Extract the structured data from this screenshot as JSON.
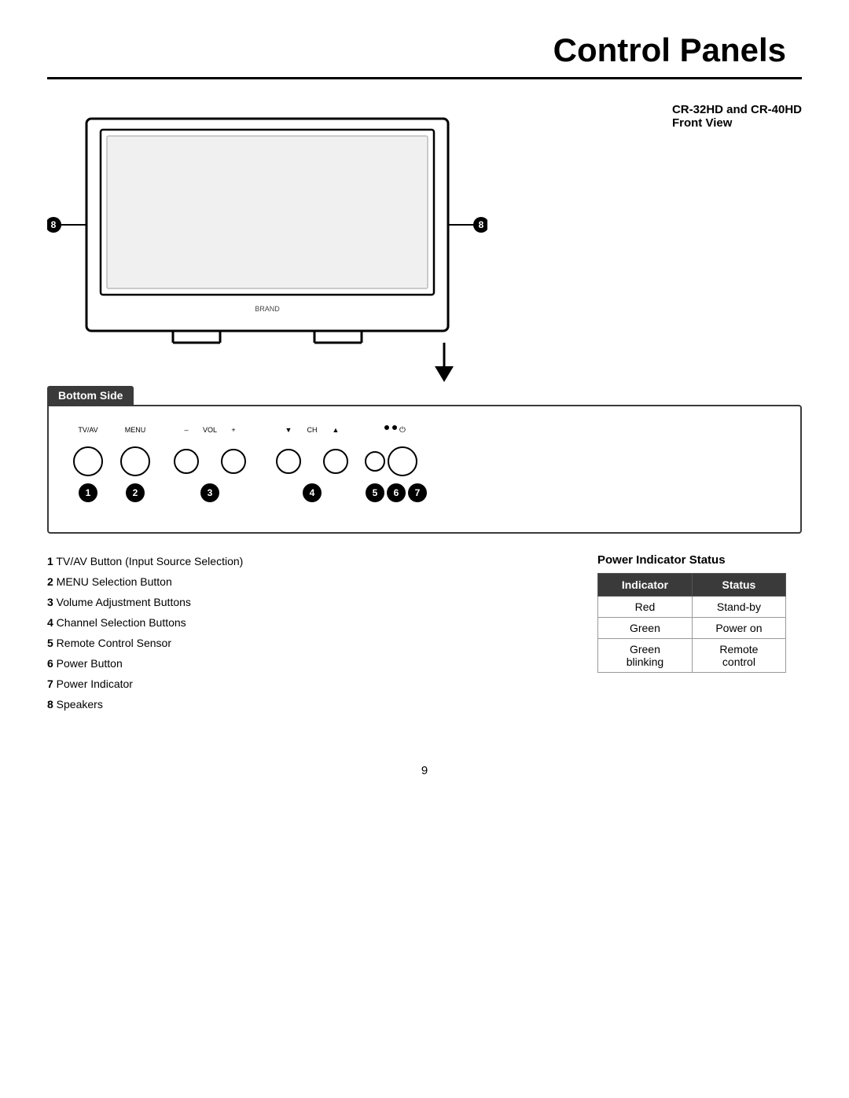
{
  "page": {
    "title": "Control Panels",
    "page_number": "9"
  },
  "header": {
    "model": "CR-32HD and CR-40HD",
    "view": "Front View"
  },
  "labels": {
    "bottom_side": "Bottom Side",
    "power_indicator_status": "Power Indicator Status"
  },
  "control_panel_labels": {
    "tv_av": "TV/AV",
    "menu": "MENU",
    "vol_minus": "–",
    "vol": "VOL",
    "vol_plus": "+",
    "ch_down": "▼",
    "ch": "CH",
    "ch_up": "▲",
    "power_icon": "⏻"
  },
  "legend": [
    {
      "num": "1",
      "text": "TV/AV Button (Input Source Selection)"
    },
    {
      "num": "2",
      "text": "MENU Selection Button"
    },
    {
      "num": "3",
      "text": "Volume Adjustment Buttons"
    },
    {
      "num": "4",
      "text": "Channel Selection Buttons"
    },
    {
      "num": "5",
      "text": "Remote Control Sensor"
    },
    {
      "num": "6",
      "text": "Power Button"
    },
    {
      "num": "7",
      "text": "Power Indicator"
    },
    {
      "num": "8",
      "text": "Speakers"
    }
  ],
  "status_table": {
    "col1_header": "Indicator",
    "col2_header": "Status",
    "rows": [
      {
        "indicator": "Red",
        "status": "Stand-by"
      },
      {
        "indicator": "Green",
        "status": "Power on"
      },
      {
        "indicator": "Green blinking",
        "status": "Remote control"
      }
    ]
  }
}
